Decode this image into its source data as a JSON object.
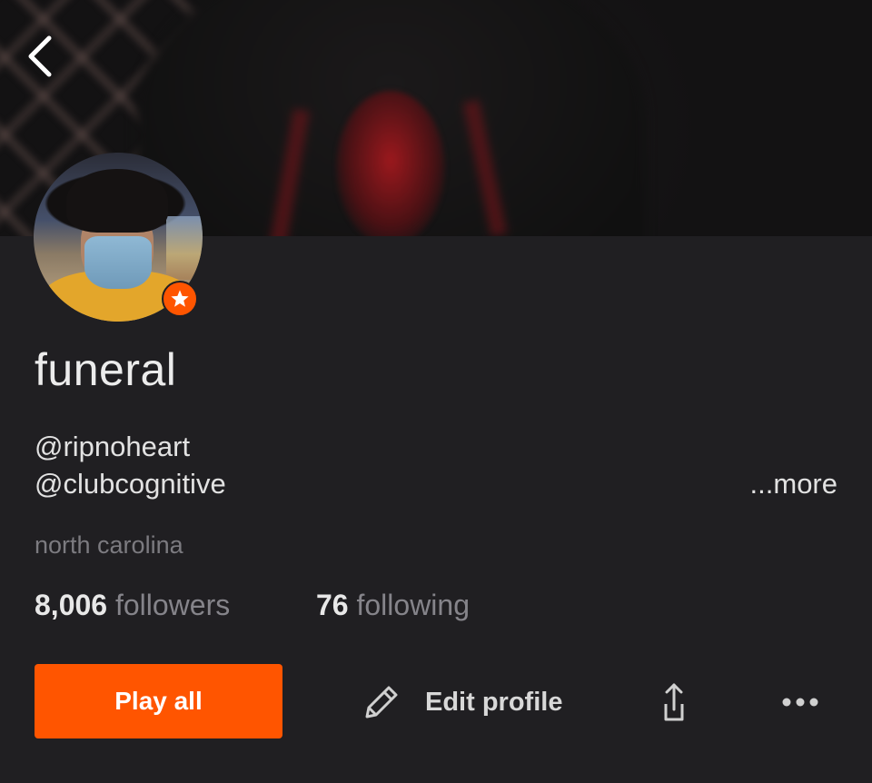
{
  "header": {
    "back_icon": "chevron-left-icon"
  },
  "profile": {
    "display_name": "funeral",
    "bio_lines": [
      "@ripnoheart",
      "@clubcognitive"
    ],
    "more_label": "...more",
    "location": "north carolina",
    "badge_icon": "star-icon",
    "badge_color": "#ff5500"
  },
  "stats": {
    "followers_count": "8,006",
    "followers_label": "followers",
    "following_count": "76",
    "following_label": "following"
  },
  "actions": {
    "play_all_label": "Play all",
    "edit_profile_label": "Edit profile",
    "edit_icon": "pencil-icon",
    "share_icon": "share-icon",
    "more_icon": "more-horizontal-icon",
    "accent_color": "#ff5500"
  }
}
